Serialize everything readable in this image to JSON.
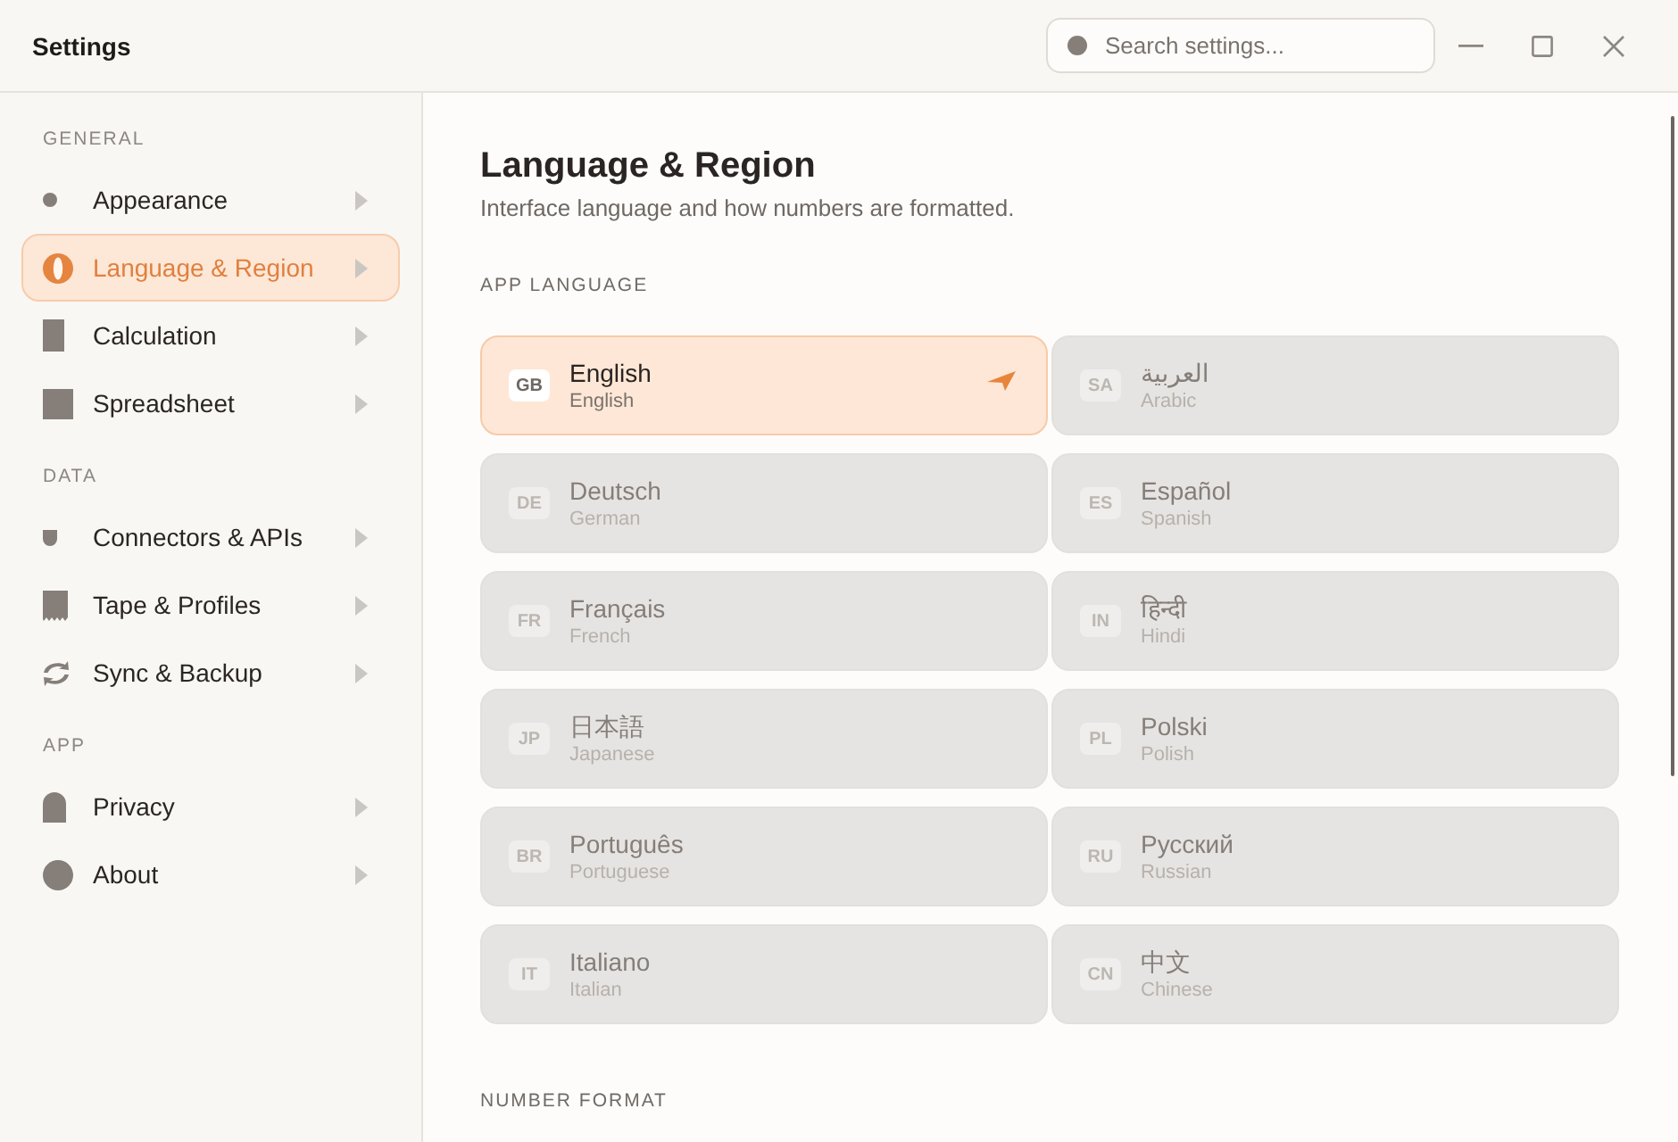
{
  "window": {
    "title": "Settings"
  },
  "search": {
    "placeholder": "Search settings..."
  },
  "sidebar": {
    "sections": [
      {
        "heading": "GENERAL",
        "items": [
          {
            "label": "Appearance",
            "selected": false
          },
          {
            "label": "Language & Region",
            "selected": true
          },
          {
            "label": "Calculation",
            "selected": false
          },
          {
            "label": "Spreadsheet",
            "selected": false
          }
        ]
      },
      {
        "heading": "DATA",
        "items": [
          {
            "label": "Connectors & APIs",
            "selected": false
          },
          {
            "label": "Tape & Profiles",
            "selected": false
          },
          {
            "label": "Sync & Backup",
            "selected": false
          }
        ]
      },
      {
        "heading": "APP",
        "items": [
          {
            "label": "Privacy",
            "selected": false
          },
          {
            "label": "About",
            "selected": false
          }
        ]
      }
    ]
  },
  "page": {
    "title": "Language & Region",
    "subtitle": "Interface language and how numbers are formatted.",
    "language_heading": "APP LANGUAGE",
    "languages": [
      {
        "code": "GB",
        "name": "English",
        "english_name": "English",
        "selected": true
      },
      {
        "code": "SA",
        "name": "العربية",
        "english_name": "Arabic",
        "selected": false
      },
      {
        "code": "DE",
        "name": "Deutsch",
        "english_name": "German",
        "selected": false
      },
      {
        "code": "ES",
        "name": "Español",
        "english_name": "Spanish",
        "selected": false
      },
      {
        "code": "FR",
        "name": "Français",
        "english_name": "French",
        "selected": false
      },
      {
        "code": "IN",
        "name": "हिन्दी",
        "english_name": "Hindi",
        "selected": false
      },
      {
        "code": "JP",
        "name": "日本語",
        "english_name": "Japanese",
        "selected": false
      },
      {
        "code": "PL",
        "name": "Polski",
        "english_name": "Polish",
        "selected": false
      },
      {
        "code": "BR",
        "name": "Português",
        "english_name": "Portuguese",
        "selected": false
      },
      {
        "code": "RU",
        "name": "Русский",
        "english_name": "Russian",
        "selected": false
      },
      {
        "code": "IT",
        "name": "Italiano",
        "english_name": "Italian",
        "selected": false
      },
      {
        "code": "CN",
        "name": "中文",
        "english_name": "Chinese",
        "selected": false
      }
    ],
    "number_format_heading": "NUMBER FORMAT"
  }
}
